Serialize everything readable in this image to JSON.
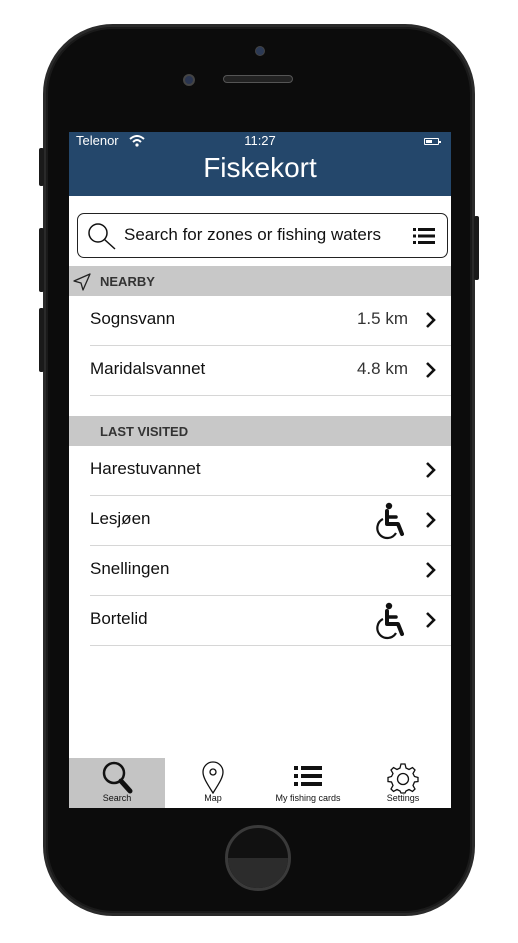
{
  "status_bar": {
    "carrier": "Telenor",
    "time": "11:27"
  },
  "header": {
    "title": "Fiskekort"
  },
  "search": {
    "placeholder": "Search for zones or fishing waters"
  },
  "nearby": {
    "label": "NEARBY",
    "items": [
      {
        "name": "Sognsvann",
        "distance": "1.5 km"
      },
      {
        "name": "Maridalsvannet",
        "distance": "4.8 km"
      }
    ]
  },
  "last_visited": {
    "label": "LAST VISITED",
    "items": [
      {
        "name": "Harestuvannet",
        "accessible": false
      },
      {
        "name": "Lesjøen",
        "accessible": true
      },
      {
        "name": "Snellingen",
        "accessible": false
      },
      {
        "name": "Bortelid",
        "accessible": true
      }
    ]
  },
  "tabbar": {
    "active": "search",
    "tabs": [
      {
        "id": "search",
        "label": "Search",
        "icon": "search-icon"
      },
      {
        "id": "map",
        "label": "Map",
        "icon": "map-pin-icon"
      },
      {
        "id": "cards",
        "label": "My fishing cards",
        "icon": "list-icon"
      },
      {
        "id": "settings",
        "label": "Settings",
        "icon": "gear-icon"
      }
    ]
  },
  "colors": {
    "header_bg": "#24476b",
    "section_bg": "#c8c8c8",
    "active_tab_bg": "#c4c4c4"
  }
}
